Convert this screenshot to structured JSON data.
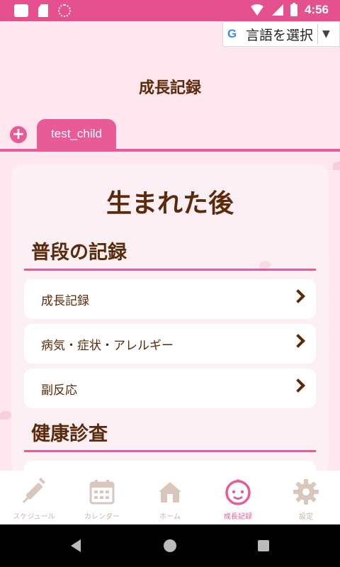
{
  "status_bar": {
    "time": "4:56"
  },
  "translate_widget": {
    "label": "言語を選択",
    "arrow": "▼",
    "logo": "G"
  },
  "page": {
    "title": "成長記録"
  },
  "tabs": {
    "add_symbol": "+",
    "active_tab": "test_child"
  },
  "card": {
    "title": "生まれた後",
    "sections": [
      {
        "title": "普段の記録",
        "items": [
          {
            "label": "成長記録"
          },
          {
            "label": "病気・症状・アレルギー"
          },
          {
            "label": "副反応"
          }
        ]
      },
      {
        "title": "健康診査",
        "items": []
      }
    ]
  },
  "bottom_nav": {
    "items": [
      {
        "label": "スケジュール",
        "icon": "syringe-icon"
      },
      {
        "label": "カレンダー",
        "icon": "calendar-icon"
      },
      {
        "label": "ホーム",
        "icon": "home-icon"
      },
      {
        "label": "成長記録",
        "icon": "baby-face-icon",
        "active": true
      },
      {
        "label": "設定",
        "icon": "gear-icon"
      }
    ]
  },
  "colors": {
    "accent": "#e95b97",
    "status_bar": "#e5508f",
    "background": "#fde6ee",
    "text_brown": "#5a2a0a",
    "nav_inactive": "#c9b4a8"
  }
}
